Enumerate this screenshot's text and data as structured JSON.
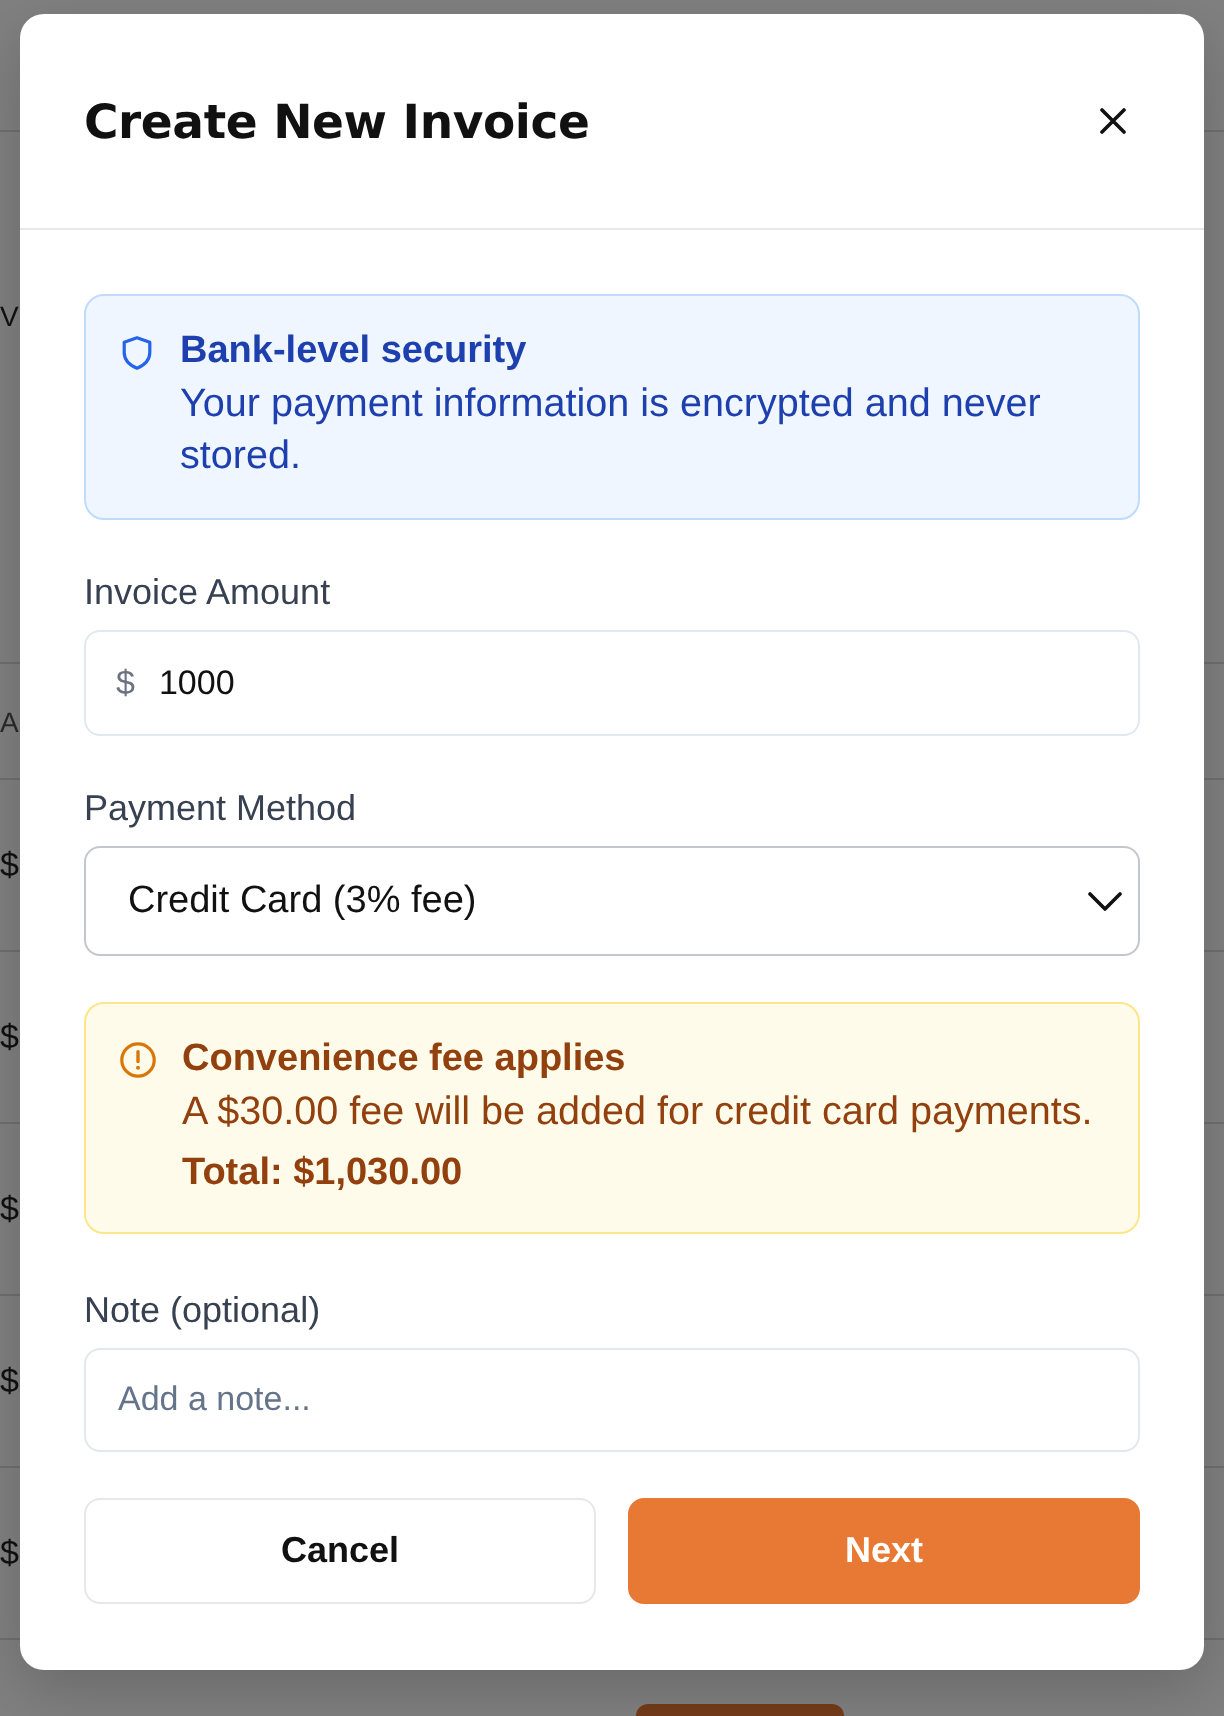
{
  "background_page": {
    "cells": [
      {
        "kind": "label",
        "text": "V"
      },
      {
        "kind": "header",
        "text": "A"
      },
      {
        "kind": "amount",
        "text": "$"
      },
      {
        "kind": "amount",
        "text": "$"
      },
      {
        "kind": "amount",
        "text": "$"
      },
      {
        "kind": "amount",
        "text": "$"
      },
      {
        "kind": "amount",
        "text": "$"
      }
    ]
  },
  "dialog": {
    "title": "Create New Invoice"
  },
  "sections": [
    {
      "kind": "info_alert",
      "title": "Bank-level security",
      "message": "Your payment information is encrypted and never stored."
    },
    {
      "kind": "amount",
      "label": "Invoice Amount",
      "prefix": "$",
      "value": "1000"
    },
    {
      "kind": "select",
      "label": "Payment Method",
      "value": "Credit Card (3% fee)"
    },
    {
      "kind": "warning_alert",
      "title": "Convenience fee applies",
      "message": "A $30.00 fee will be added for credit card payments.",
      "total": "Total: $1,030.00"
    },
    {
      "kind": "text",
      "label": "Note (optional)",
      "placeholder": "Add a note..."
    }
  ],
  "buttons": [
    {
      "label": "Cancel",
      "kind": "secondary"
    },
    {
      "label": "Next",
      "kind": "primary"
    }
  ]
}
